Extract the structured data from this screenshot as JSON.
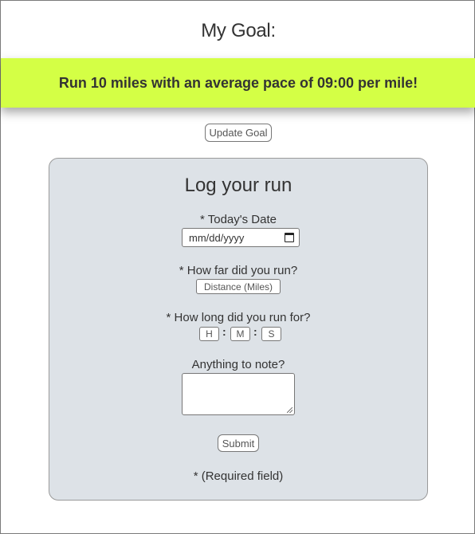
{
  "goal": {
    "title": "My Goal:",
    "text": "Run 10 miles with an average pace of 09:00 per mile!",
    "update_label": "Update Goal",
    "banner_color": "#d4ff45"
  },
  "log": {
    "title": "Log your run",
    "date_label": "* Today's Date",
    "date_placeholder": "mm/dd/yyyy",
    "distance_label": "* How far did you run?",
    "distance_placeholder": "Distance (Miles)",
    "duration_label": "* How long did you run for?",
    "hours_placeholder": "H",
    "minutes_placeholder": "M",
    "seconds_placeholder": "S",
    "separator": ":",
    "note_label": "Anything to note?",
    "note_value": "",
    "submit_label": "Submit",
    "required_note": "* (Required field)",
    "card_color": "#dde2e7"
  }
}
